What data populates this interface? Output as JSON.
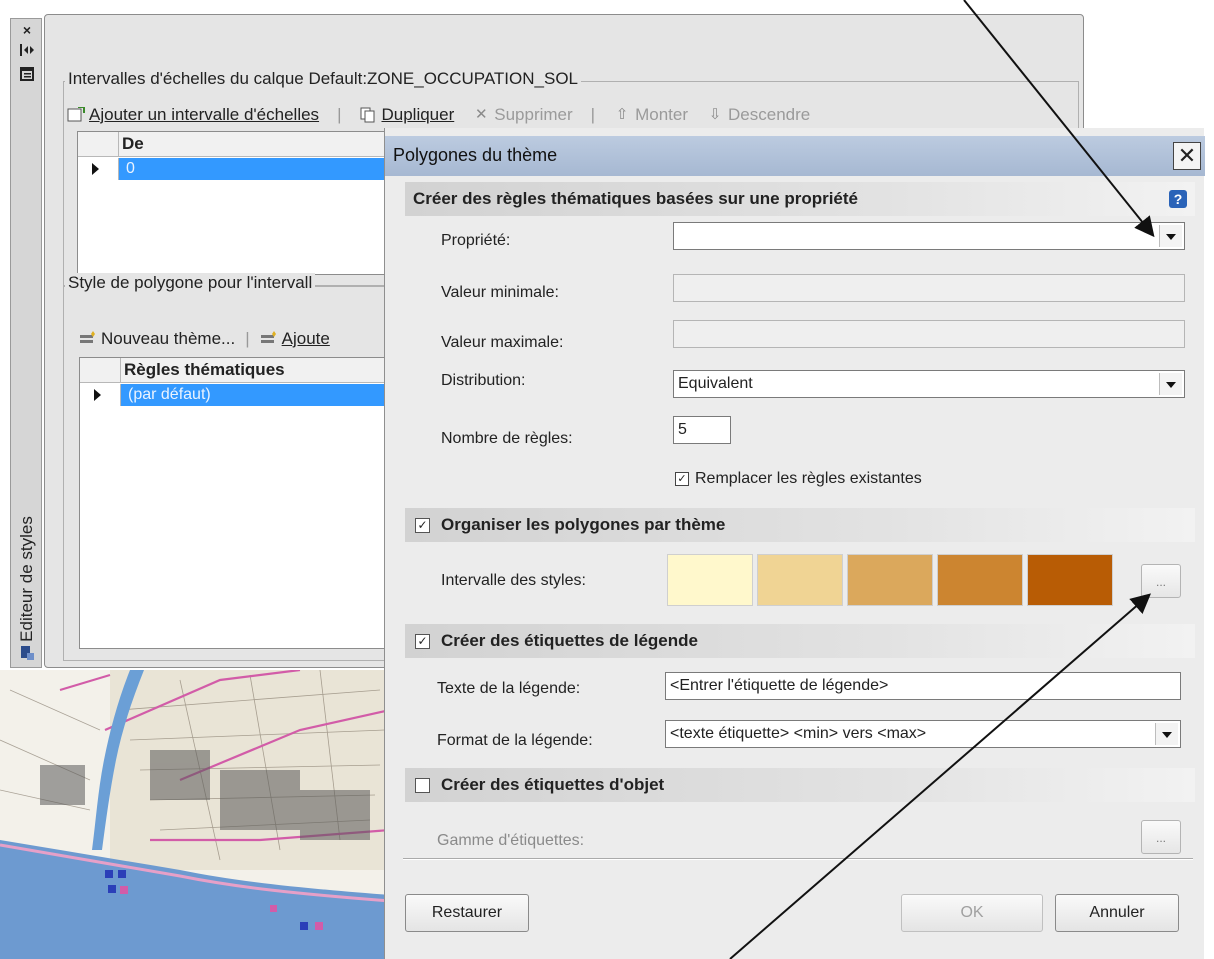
{
  "palette": {
    "close_glyph": "×",
    "vertical_title": "Editeur de styles"
  },
  "editor": {
    "scale_group_title": "Intervalles d'échelles du calque Default:ZONE_OCCUPATION_SOL",
    "scale_toolbar": {
      "add": "Ajouter un intervalle d'échelles",
      "duplicate": "Dupliquer",
      "delete": "Supprimer",
      "up": "Monter",
      "down": "Descendre"
    },
    "scale_grid": {
      "column": "De",
      "row_value": "0"
    },
    "style_group_title": "Style de polygone pour l'intervall",
    "style_toolbar": {
      "new_theme": "Nouveau thème...",
      "add": "Ajoute"
    },
    "style_grid": {
      "column": "Règles thématiques",
      "row_value": "(par défaut)"
    }
  },
  "dialog": {
    "title": "Polygones du thème",
    "close_glyph": "✕",
    "section_rules": {
      "title": "Créer des règles thématiques basées sur une propriété",
      "help_glyph": "?"
    },
    "property_label": "Propriété:",
    "property_value": "",
    "min_label": "Valeur minimale:",
    "min_value": "",
    "max_label": "Valeur maximale:",
    "max_value": "",
    "distribution_label": "Distribution:",
    "distribution_value": "Equivalent",
    "rule_count_label": "Nombre de règles:",
    "rule_count_value": "5",
    "replace_rules_label": "Remplacer les règles existantes",
    "replace_rules_checked": true,
    "section_organize": {
      "title": "Organiser les polygones par thème",
      "checked": true
    },
    "styles_range_label": "Intervalle des styles:",
    "style_swatches": [
      "#fff8cc",
      "#f0d494",
      "#dba85c",
      "#cc8530",
      "#b85c05"
    ],
    "ellipsis_label": "...",
    "section_legend": {
      "title": "Créer des étiquettes de légende",
      "checked": true
    },
    "legend_text_label": "Texte de la légende:",
    "legend_text_value": "<Entrer l'étiquette de légende>",
    "legend_format_label": "Format de la légende:",
    "legend_format_value": "<texte étiquette> <min> vers <max>",
    "section_object_labels": {
      "title": "Créer des étiquettes d'objet",
      "checked": false
    },
    "label_range_label": "Gamme d'étiquettes:",
    "buttons": {
      "restore": "Restaurer",
      "ok": "OK",
      "cancel": "Annuler"
    }
  },
  "colors": {
    "selection_blue": "#3399ff",
    "titlebar_blue": "#afc0d8",
    "help_blue": "#2a63b8"
  }
}
